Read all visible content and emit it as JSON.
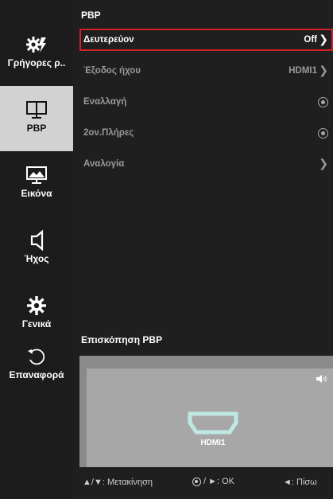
{
  "sidebar": {
    "items": [
      {
        "icon": "quick-settings-icon",
        "label": "Γρήγορες ρ..",
        "active": false
      },
      {
        "icon": "pbp-icon",
        "label": "PBP",
        "active": true
      },
      {
        "icon": "picture-icon",
        "label": "Εικόνα",
        "active": false
      },
      {
        "icon": "speaker-icon",
        "label": "Ήχος",
        "active": false
      },
      {
        "icon": "gear-icon",
        "label": "Γενικά",
        "active": false
      },
      {
        "icon": "reset-icon",
        "label": "Επαναφορά",
        "active": false
      }
    ]
  },
  "panel": {
    "title": "PBP",
    "rows": [
      {
        "label": "Δευτερεύον",
        "value": "Off",
        "control": "arrow",
        "arrow": "❯",
        "selected": true
      },
      {
        "label": "Έξοδος ήχου",
        "value": "HDMI1",
        "control": "arrow",
        "arrow": "❯",
        "selected": false
      },
      {
        "label": "Εναλλαγή",
        "control": "radio",
        "selected": false
      },
      {
        "label": "2ον.Πλήρες",
        "control": "radio",
        "selected": false
      },
      {
        "label": "Αναλογία",
        "control": "arrow",
        "arrow": "❯",
        "selected": false
      }
    ]
  },
  "preview": {
    "title": "Επισκόπηση PBP",
    "input_label": "HDMI1"
  },
  "footer": {
    "move_hint": "▲/▼: Μετακίνηση",
    "ok_hint": "/ ►: OK",
    "back_hint": "◄: Πίσω"
  },
  "colors": {
    "highlight_border": "#d02028",
    "sidebar_bg": "#1c1c1c",
    "panel_bg": "#1f1f1f",
    "hdmi_accent": "#bfe8e4"
  }
}
